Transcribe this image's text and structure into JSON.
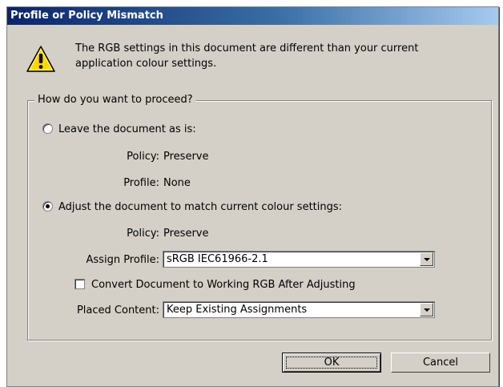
{
  "dialog": {
    "title": "Profile or Policy Mismatch",
    "icon": "warning-icon",
    "message_line1": "The RGB settings in this document are different than your current",
    "message_line2": "application colour settings."
  },
  "group": {
    "legend": "How do you want to proceed?",
    "option_leave": {
      "label": "Leave the document as is:",
      "selected": false,
      "policy_label": "Policy:",
      "policy_value": "Preserve",
      "profile_label": "Profile:",
      "profile_value": "None"
    },
    "option_adjust": {
      "label": "Adjust the document to match current colour settings:",
      "selected": true,
      "policy_label": "Policy:",
      "policy_value": "Preserve",
      "assign_profile_label": "Assign Profile:",
      "assign_profile_value": "sRGB IEC61966-2.1",
      "convert_label": "Convert Document to Working RGB After Adjusting",
      "convert_checked": false,
      "placed_content_label": "Placed Content:",
      "placed_content_value": "Keep Existing Assignments"
    }
  },
  "buttons": {
    "ok": "OK",
    "cancel": "Cancel"
  },
  "colors": {
    "titlebar_start": "#0a246a",
    "titlebar_end": "#a6caf0",
    "dialog_bg": "#d4d0c8",
    "warning_yellow": "#ffd700"
  }
}
